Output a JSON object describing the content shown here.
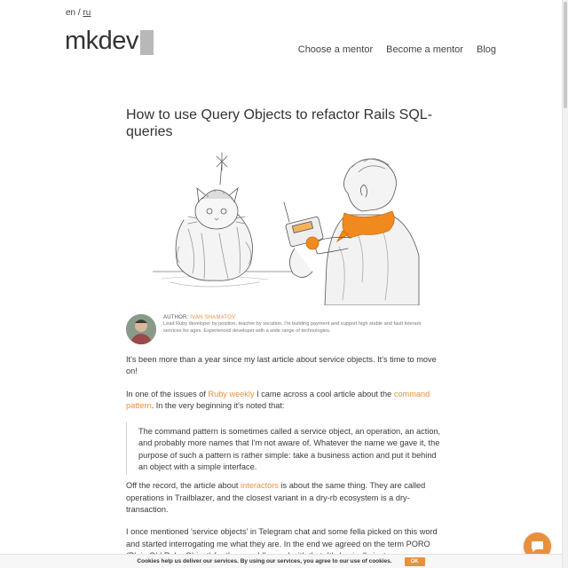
{
  "lang": {
    "en": "en",
    "sep": " / ",
    "ru": "ru"
  },
  "logo": {
    "text": "mkdev"
  },
  "nav": {
    "items": [
      "Choose a mentor",
      "Become a mentor",
      "Blog"
    ]
  },
  "article": {
    "title": "How to use Query Objects to refactor Rails SQL-queries",
    "author": {
      "label": "AUTHOR:",
      "name": "IVAN SHAMATOV",
      "bio": "Lead Ruby developer by position, teacher by vocation. I'm building payment and support high stable and fault tolerant services for ages. Experienced developer with a wide range of technologies."
    },
    "p1": "It's been more than a year since my last article about service objects. It's time to move on!",
    "p2": {
      "t1": "In one of the issues of ",
      "link1": "Ruby weekly",
      "t2": " I came across a cool article about the ",
      "link2": "command pattern",
      "t3": ". In the very beginning it's noted that:"
    },
    "quote": "The command pattern is sometimes called a service object, an operation, an action, and probably more names that I'm not aware of. Whatever the name we gave it, the purpose of such a pattern is rather simple: take a business action and put it behind an object with a simple interface.",
    "p3": {
      "t1": "Off the record, the article about ",
      "link": "interactors",
      "t2": " is about the same thing. They are called operations in Trailblazer, and the closest variant in a dry-rb ecosystem is a dry-transaction."
    },
    "p4": "I once mentioned 'service objects' in Telegram chat and some fella picked on this word and started interrogating me what they are. In the end we agreed on the term PORO (Plain Old Ruby Object) for them and I'm cool with that. It's basically just a"
  },
  "cookie": {
    "text": "Cookies help us deliver our services. By using our services, you agree to our use of cookies.",
    "ok": "OK"
  },
  "colors": {
    "accent": "#e8913d",
    "scarf": "#f08a1e"
  }
}
